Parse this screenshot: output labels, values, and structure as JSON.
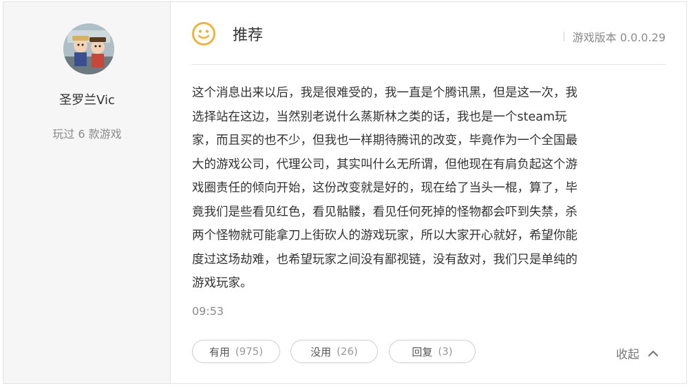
{
  "user": {
    "name": "圣罗兰Vic",
    "played_text": "玩过 6 款游戏"
  },
  "review": {
    "recommend_label": "推荐",
    "version_text": "游戏版本 0.0.0.29",
    "content": "这个消息出来以后，我是很难受的，我一直是个腾讯黑，但是这一次，我\n选择站在这边，当然别老说什么蒸斯林之类的话，我也是一个steam玩\n家，而且买的也不少，但我也一样期待腾讯的改变，毕竟作为一个全国最\n大的游戏公司，代理公司，其实叫什么无所谓，但他现在有肩负起这个游\n戏圈责任的倾向开始，这份改变就是好的，现在给了当头一棍，算了，毕\n竟我们是些看见红色，看见骷髅，看见任何死掉的怪物都会吓到失禁，杀\n两个怪物就可能拿刀上街砍人的游戏玩家，所以大家开心就好，希望你能\n度过这场劫难，也希望玩家之间没有鄙视链，没有敌对，我们只是单纯的\n游戏玩家。",
    "time": "09:53"
  },
  "actions": {
    "useful_label": "有用",
    "useful_count": "(975)",
    "useless_label": "没用",
    "useless_count": "(26)",
    "reply_label": "回复",
    "reply_count": "(3)",
    "collapse_label": "收起"
  },
  "icons": {
    "recommend": "smile-icon",
    "collapse": "chevron-up-icon"
  },
  "colors": {
    "smile_icon": "#f0b23e",
    "left_panel_bg": "#f6f6f6",
    "muted_text": "#8a8a8a"
  }
}
